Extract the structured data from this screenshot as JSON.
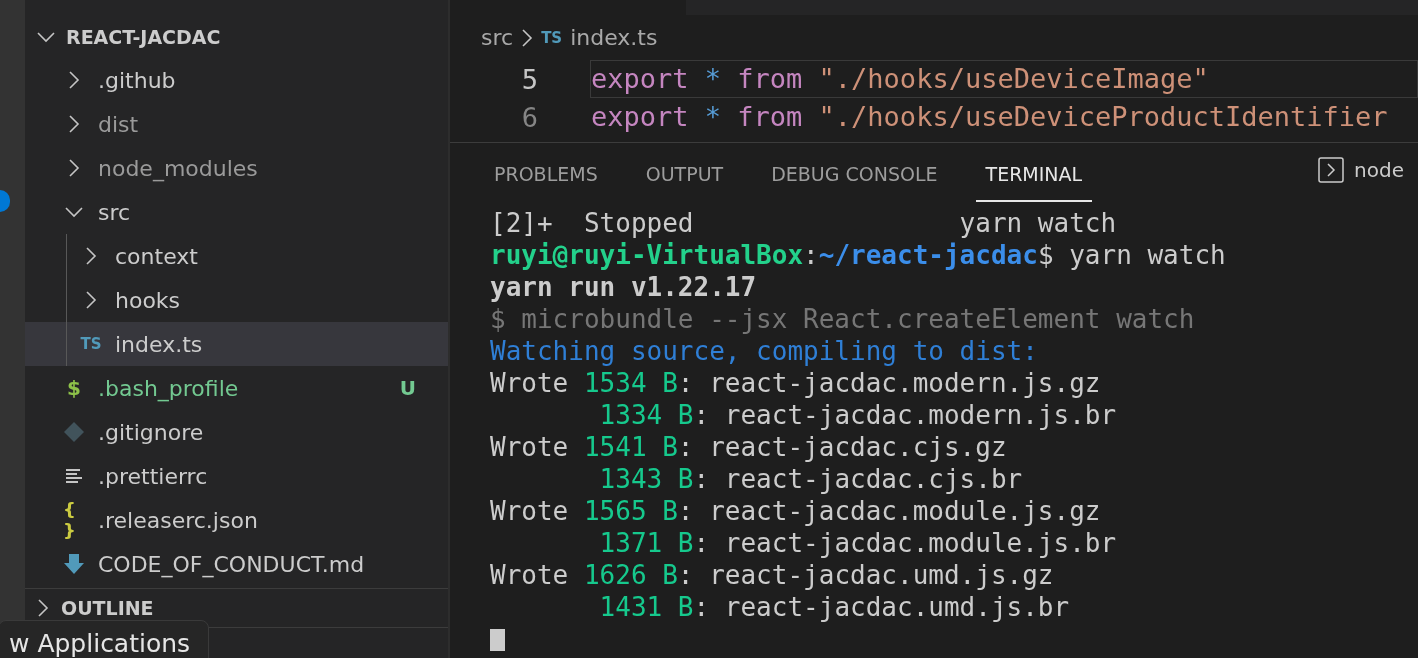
{
  "explorer": {
    "title": "REACT-JACDAC",
    "expanded": true,
    "items": [
      {
        "label": ".github",
        "kind": "folder",
        "expanded": false,
        "selected": false
      },
      {
        "label": "dist",
        "kind": "folder",
        "expanded": false,
        "selected": false
      },
      {
        "label": "node_modules",
        "kind": "folder",
        "expanded": false,
        "selected": false
      },
      {
        "label": "src",
        "kind": "folder",
        "expanded": true,
        "selected": false,
        "children": [
          {
            "label": "context",
            "kind": "folder",
            "expanded": false,
            "selected": false
          },
          {
            "label": "hooks",
            "kind": "folder",
            "expanded": false,
            "selected": false
          },
          {
            "label": "index.ts",
            "kind": "ts",
            "icon_text": "TS",
            "selected": true
          }
        ]
      },
      {
        "label": ".bash_profile",
        "kind": "shell",
        "icon_text": "$",
        "badge": "U",
        "selected": false
      },
      {
        "label": ".gitignore",
        "kind": "git",
        "selected": false
      },
      {
        "label": ".prettierrc",
        "kind": "text",
        "selected": false
      },
      {
        "label": ".releaserc.json",
        "kind": "json",
        "icon_text": "{ }",
        "selected": false
      },
      {
        "label": "CODE_OF_CONDUCT.md",
        "kind": "markdown",
        "selected": false
      }
    ]
  },
  "outline": {
    "title": "OUTLINE",
    "expanded": false
  },
  "tooltip": "w Applications",
  "breadcrumb": [
    {
      "label": "src",
      "kind": "folder"
    },
    {
      "label": "index.ts",
      "kind": "ts",
      "icon_text": "TS"
    }
  ],
  "code_lines": [
    {
      "number": "5",
      "current": true,
      "segments": [
        {
          "text": "export ",
          "kind": "keyword"
        },
        {
          "text": "* ",
          "kind": "operator"
        },
        {
          "text": "from ",
          "kind": "keyword"
        },
        {
          "text": "\"./hooks/useDeviceImage\"",
          "kind": "string"
        }
      ]
    },
    {
      "number": "6",
      "current": false,
      "segments": [
        {
          "text": "export ",
          "kind": "keyword"
        },
        {
          "text": "* ",
          "kind": "operator"
        },
        {
          "text": "from ",
          "kind": "keyword"
        },
        {
          "text": "\"./hooks/useDeviceProductIdentifier",
          "kind": "string"
        }
      ]
    }
  ],
  "panel_tabs": [
    {
      "label": "PROBLEMS",
      "selected": false
    },
    {
      "label": "OUTPUT",
      "selected": false
    },
    {
      "label": "DEBUG CONSOLE",
      "selected": false
    },
    {
      "label": "TERMINAL",
      "selected": true
    }
  ],
  "terminal_selector": "node",
  "terminal": [
    [
      {
        "text": "[2]+  Stopped                 yarn watch"
      }
    ],
    [
      {
        "text": "ruyi@ruyi-VirtualBox",
        "kind": "user"
      },
      {
        "text": ":"
      },
      {
        "text": "~/react-jacdac",
        "kind": "path"
      },
      {
        "text": "$ yarn watch"
      }
    ],
    [
      {
        "text": "yarn run v1.22.17",
        "kind": "bold"
      }
    ],
    [
      {
        "text": "$ microbundle --jsx React.createElement watch",
        "kind": "dim"
      }
    ],
    [
      {
        "text": "Watching source, compiling to dist:",
        "kind": "info"
      }
    ],
    [
      {
        "text": "Wrote "
      },
      {
        "text": "1534 B",
        "kind": "size"
      },
      {
        "text": ": react-jacdac.modern.js.gz"
      }
    ],
    [
      {
        "text": "       1334 B",
        "kind": "size"
      },
      {
        "text": ": react-jacdac.modern.js.br"
      }
    ],
    [
      {
        "text": "Wrote "
      },
      {
        "text": "1541 B",
        "kind": "size"
      },
      {
        "text": ": react-jacdac.cjs.gz"
      }
    ],
    [
      {
        "text": "       1343 B",
        "kind": "size"
      },
      {
        "text": ": react-jacdac.cjs.br"
      }
    ],
    [
      {
        "text": "Wrote "
      },
      {
        "text": "1565 B",
        "kind": "size"
      },
      {
        "text": ": react-jacdac.module.js.gz"
      }
    ],
    [
      {
        "text": "       1371 B",
        "kind": "size"
      },
      {
        "text": ": react-jacdac.module.js.br"
      }
    ],
    [
      {
        "text": "Wrote "
      },
      {
        "text": "1626 B",
        "kind": "size"
      },
      {
        "text": ": react-jacdac.umd.js.gz"
      }
    ],
    [
      {
        "text": "       1431 B",
        "kind": "size"
      },
      {
        "text": ": react-jacdac.umd.js.br"
      }
    ]
  ]
}
